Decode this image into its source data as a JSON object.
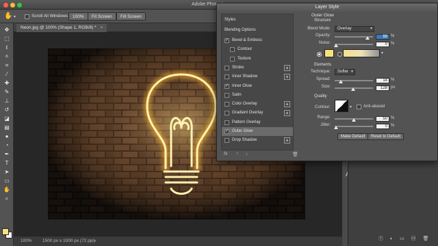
{
  "app": {
    "title": "Adobe Photoshop"
  },
  "colors": {
    "neon": "#f7e27a",
    "accent": "#3b77c2",
    "wall": "#3a2a20"
  },
  "options_bar": {
    "scroll_all_windows_label": "Scroll All Windows",
    "zoom_value": "100%",
    "fit_screen_label": "Fit Screen",
    "fill_screen_label": "Fill Screen"
  },
  "document": {
    "tab_label": "Neon.jpg @ 100% (Shape 1, RGB/8) *",
    "zoom": "100%",
    "doc_info": "1500 px x 1000 px (72 ppi)"
  },
  "tools": [
    "move-icon",
    "marquee-icon",
    "lasso-icon",
    "magic-wand-icon",
    "crop-icon",
    "eyedropper-icon",
    "healing-brush-icon",
    "brush-icon",
    "clone-stamp-icon",
    "history-brush-icon",
    "eraser-icon",
    "gradient-icon",
    "blur-icon",
    "dodge-icon",
    "pen-icon",
    "type-icon",
    "path-select-icon",
    "shape-icon",
    "hand-icon",
    "zoom-icon"
  ],
  "dialog": {
    "title": "Layer Style",
    "styles_header": "Styles",
    "blending_options": "Blending Options",
    "effects": [
      {
        "label": "Bevel & Emboss",
        "checked": true,
        "sub": false,
        "plus": false
      },
      {
        "label": "Contour",
        "checked": false,
        "sub": true,
        "plus": false
      },
      {
        "label": "Texture",
        "checked": false,
        "sub": true,
        "plus": false
      },
      {
        "label": "Stroke",
        "checked": false,
        "sub": false,
        "plus": true
      },
      {
        "label": "Inner Shadow",
        "checked": false,
        "sub": false,
        "plus": true
      },
      {
        "label": "Inner Glow",
        "checked": true,
        "sub": false,
        "plus": false
      },
      {
        "label": "Satin",
        "checked": false,
        "sub": false,
        "plus": false
      },
      {
        "label": "Color Overlay",
        "checked": false,
        "sub": false,
        "plus": true
      },
      {
        "label": "Gradient Overlay",
        "checked": false,
        "sub": false,
        "plus": true
      },
      {
        "label": "Pattern Overlay",
        "checked": false,
        "sub": false,
        "plus": false
      },
      {
        "label": "Outer Glow",
        "checked": true,
        "sub": false,
        "plus": false,
        "selected": true
      },
      {
        "label": "Drop Shadow",
        "checked": false,
        "sub": false,
        "plus": true
      }
    ],
    "footer_fx": "fx",
    "settings": {
      "section_title": "Outer Glow",
      "structure_title": "Structure",
      "blend_mode_label": "Blend Mode:",
      "blend_mode_value": "Overlay",
      "opacity_label": "Opacity:",
      "opacity_value": "99",
      "noise_label": "Noise:",
      "noise_value": "0",
      "pct": "%",
      "elements_title": "Elements",
      "technique_label": "Technique:",
      "technique_value": "Softer",
      "spread_label": "Spread:",
      "spread_value": "14",
      "size_label": "Size:",
      "size_value": "128",
      "px": "px",
      "quality_title": "Quality",
      "contour_label": "Contour:",
      "anti_aliased_label": "Anti-aliased",
      "range_label": "Range:",
      "range_value": "50",
      "jitter_label": "Jitter:",
      "jitter_value": "0",
      "make_default_label": "Make Default",
      "reset_default_label": "Reset to Default"
    }
  }
}
